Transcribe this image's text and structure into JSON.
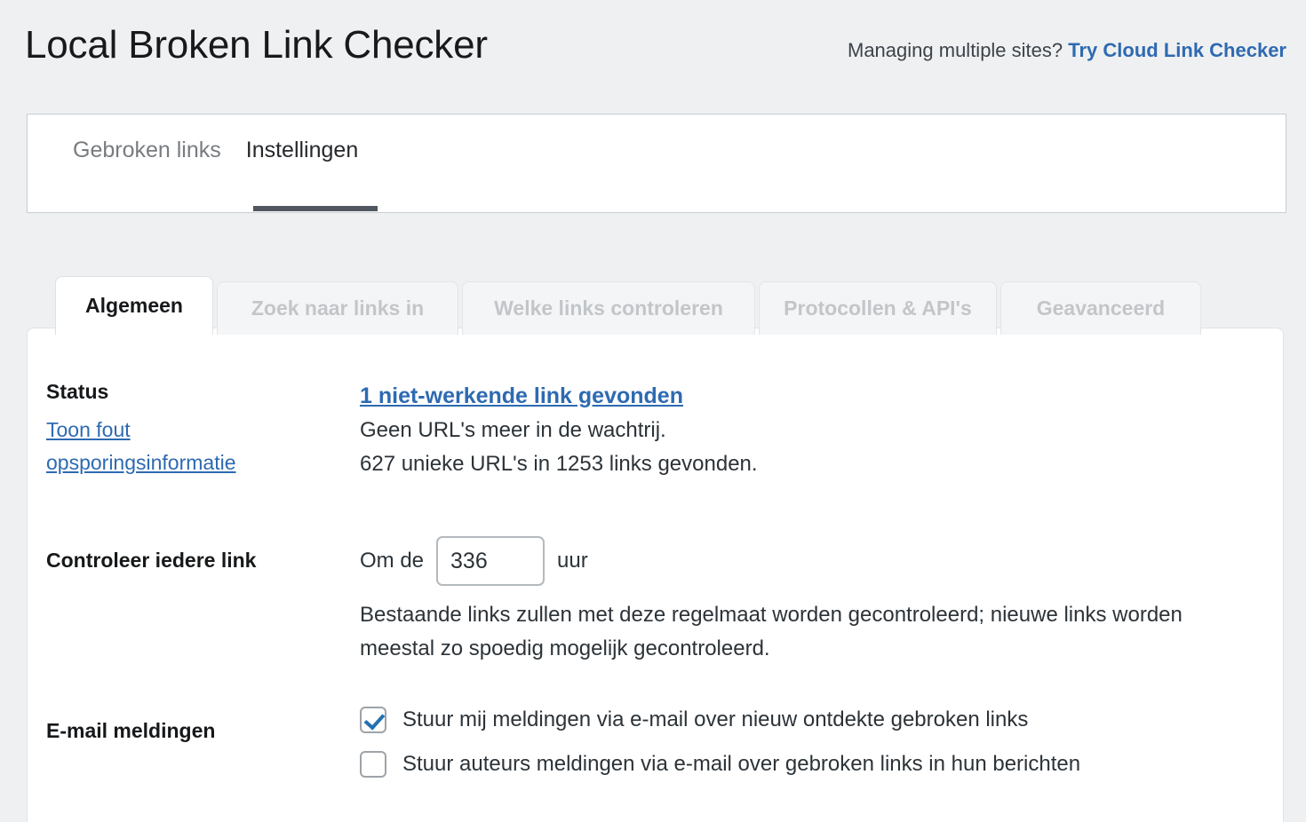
{
  "header": {
    "title": "Local Broken Link Checker",
    "promo_text": "Managing multiple sites?",
    "promo_link": "Try Cloud Link Checker"
  },
  "nav": {
    "tabs": [
      {
        "label": "Gebroken links",
        "active": false
      },
      {
        "label": "Instellingen",
        "active": true
      }
    ]
  },
  "subtabs": [
    {
      "label": "Algemeen",
      "active": true
    },
    {
      "label": "Zoek naar links in",
      "active": false
    },
    {
      "label": "Welke links controleren",
      "active": false
    },
    {
      "label": "Protocollen & API's",
      "active": false
    },
    {
      "label": "Geavanceerd",
      "active": false
    }
  ],
  "settings": {
    "status": {
      "label": "Status",
      "debug_link": "Toon fout opsporingsinformatie",
      "broken_link_summary": "1 niet-werkende link gevonden",
      "queue_line": "Geen URL's meer in de wachtrij.",
      "totals_line": "627 unieke URL's in 1253 links gevonden."
    },
    "interval": {
      "label": "Controleer iedere link",
      "prefix": "Om de",
      "value": "336",
      "suffix": "uur",
      "description": "Bestaande links zullen met deze regelmaat worden gecontroleerd; nieuwe links worden meestal zo spoedig mogelijk gecontroleerd."
    },
    "email": {
      "label": "E-mail meldingen",
      "options": [
        {
          "label": "Stuur mij meldingen via e-mail over nieuw ontdekte gebroken links",
          "checked": true
        },
        {
          "label": "Stuur auteurs meldingen via e-mail over gebroken links in hun berichten",
          "checked": false
        }
      ]
    }
  },
  "colors": {
    "page_background": "#eff0f1",
    "link_blue": "#2e6ab1",
    "accent_blue": "#2271b1",
    "text_dark": "#2c3338",
    "muted": "#787c80"
  }
}
